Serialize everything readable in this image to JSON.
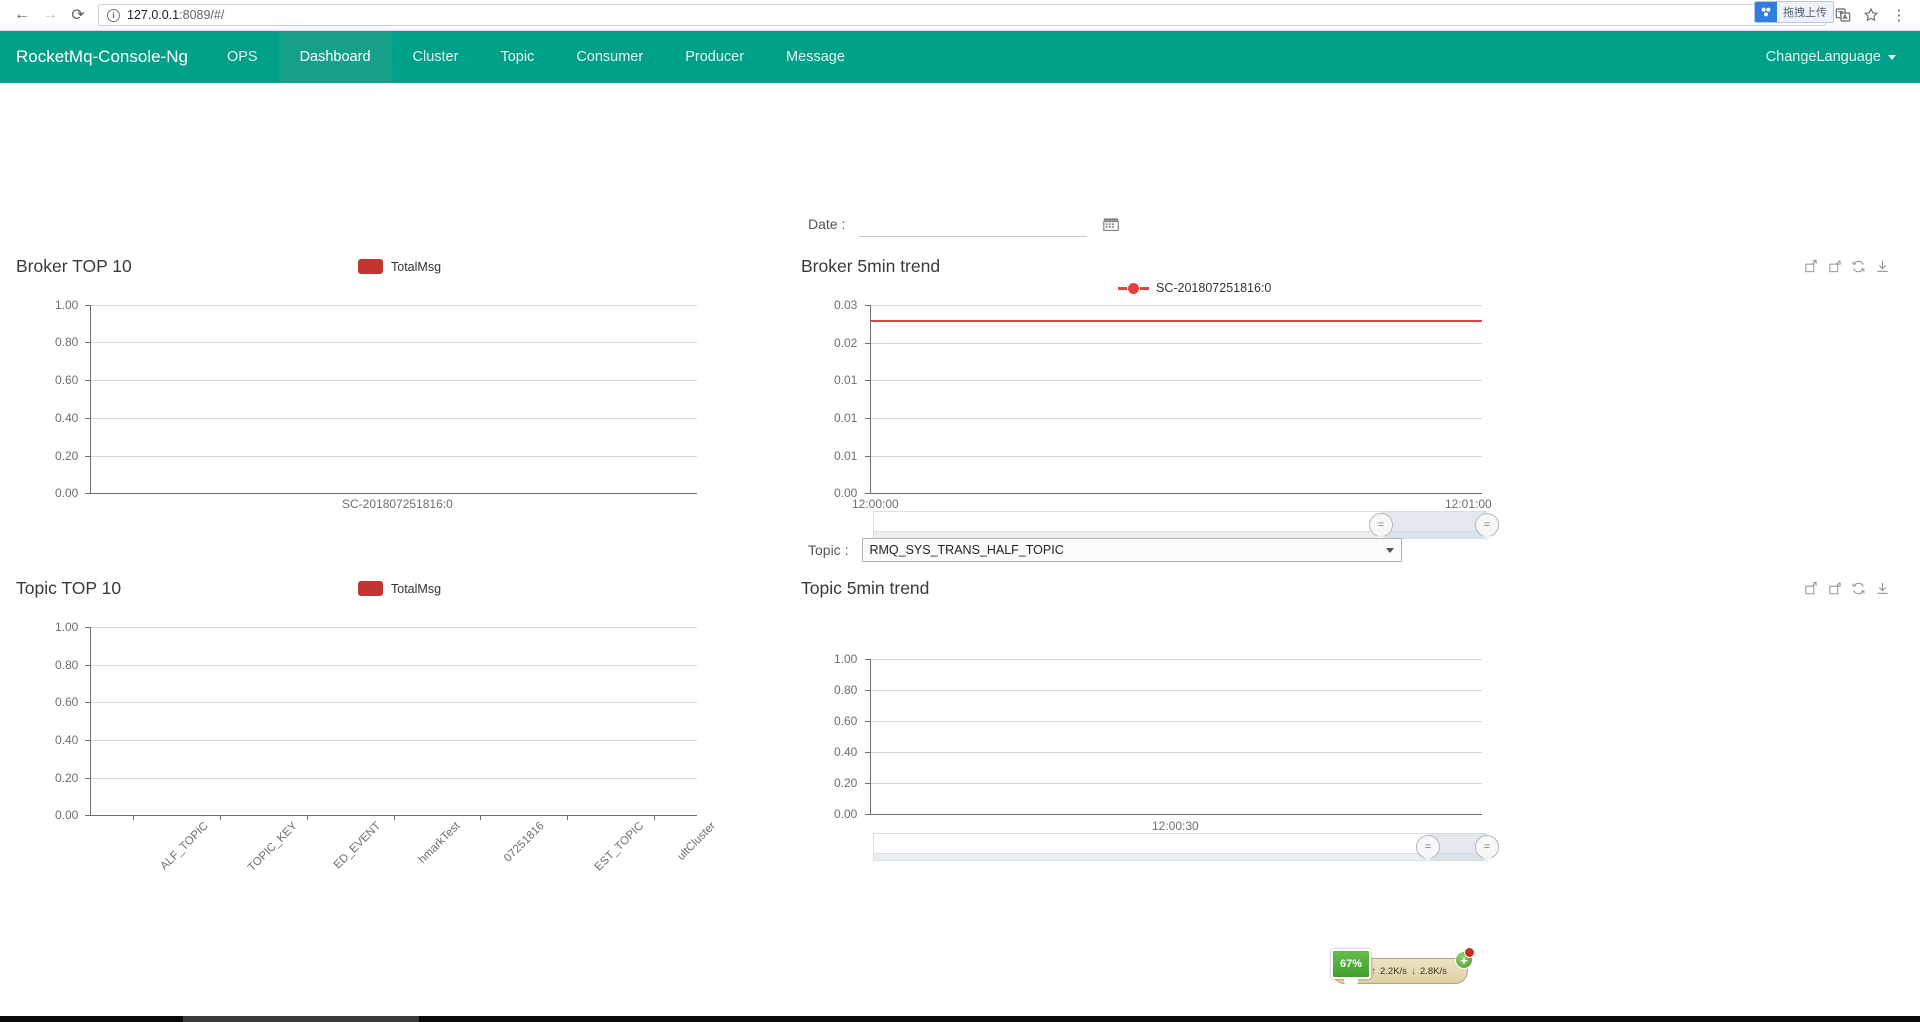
{
  "browser": {
    "back_icon": "back-arrow-icon",
    "forward_icon": "forward-arrow-icon",
    "reload_icon": "reload-icon",
    "url_host": "127.0.0.1",
    "url_rest": ":8089/#/",
    "extension_badge_label": "拖拽上传",
    "translate_icon": "translate-icon",
    "bookmark_icon": "star-icon",
    "menu_icon": "three-dots-menu-icon"
  },
  "appnav": {
    "brand": "RocketMq-Console-Ng",
    "items": [
      {
        "label": "OPS",
        "active": false
      },
      {
        "label": "Dashboard",
        "active": true
      },
      {
        "label": "Cluster",
        "active": false
      },
      {
        "label": "Topic",
        "active": false
      },
      {
        "label": "Consumer",
        "active": false
      },
      {
        "label": "Producer",
        "active": false
      },
      {
        "label": "Message",
        "active": false
      }
    ],
    "language_label": "ChangeLanguage",
    "accent_color": "#00a088",
    "active_color": "#169f89"
  },
  "date_filter": {
    "label": "Date :",
    "value": "",
    "placeholder": "",
    "calendar_icon": "calendar-icon"
  },
  "topic_filter": {
    "label": "Topic :",
    "selected": "RMQ_SYS_TRANS_HALF_TOPIC"
  },
  "toolbox": {
    "datazoom_label": "data-zoom-icon",
    "restore_label": "restore-icon",
    "refresh_label": "refresh-icon",
    "download_label": "download-icon"
  },
  "net_widget": {
    "cpu": "67%",
    "upload": "2.2K/s",
    "download": "2.8K/s",
    "up_arrow": "↑",
    "down_arrow": "↓",
    "plus": "+"
  },
  "chart_data": [
    {
      "id": "broker-top10",
      "type": "bar",
      "title": "Broker TOP 10",
      "legend": [
        "TotalMsg"
      ],
      "legend_position": "top-center",
      "categories": [
        "SC-201807251816:0"
      ],
      "series": [
        {
          "name": "TotalMsg",
          "values": [
            0
          ],
          "color": "#c23531"
        }
      ],
      "xlabel": "",
      "ylabel": "",
      "ylim": [
        0,
        1
      ],
      "yticks": [
        "0.00",
        "0.20",
        "0.40",
        "0.60",
        "0.80",
        "1.00"
      ],
      "grid": true
    },
    {
      "id": "broker-5min-trend",
      "type": "line",
      "title": "Broker 5min trend",
      "legend": [
        "SC-201807251816:0"
      ],
      "legend_position": "top-center",
      "x": [
        "12:00:00",
        "12:01:00"
      ],
      "xticks": [
        "12:00:00",
        "12:01:00"
      ],
      "series": [
        {
          "name": "SC-201807251816:0",
          "values": [
            0.0245,
            0.0245
          ],
          "color": "#e8403a"
        }
      ],
      "xlabel": "",
      "ylabel": "",
      "ylim": [
        0,
        0.03
      ],
      "yticks": [
        "0.00",
        "0.01",
        "0.01",
        "0.01",
        "0.02",
        "0.03"
      ],
      "grid": true,
      "datazoom": {
        "start": 0,
        "end": 88
      }
    },
    {
      "id": "topic-top10",
      "type": "bar",
      "title": "Topic TOP 10",
      "legend": [
        "TotalMsg"
      ],
      "legend_position": "top-center",
      "categories": [
        "ALF_TOPIC",
        "TOPIC_KEY",
        "ED_EVENT",
        "hmarkTest",
        "07251816",
        "EST_TOPIC",
        "ultCluster"
      ],
      "series": [
        {
          "name": "TotalMsg",
          "values": [
            0,
            0,
            0,
            0,
            0,
            0,
            0
          ],
          "color": "#c23531"
        }
      ],
      "xlabel": "",
      "ylabel": "",
      "ylim": [
        0,
        1
      ],
      "yticks": [
        "0.00",
        "0.20",
        "0.40",
        "0.60",
        "0.80",
        "1.00"
      ],
      "grid": true
    },
    {
      "id": "topic-5min-trend",
      "type": "line",
      "title": "Topic 5min trend",
      "legend": [],
      "x": [
        "12:00:30"
      ],
      "xticks": [
        "12:00:30"
      ],
      "series": [],
      "xlabel": "",
      "ylabel": "",
      "ylim": [
        0,
        1
      ],
      "yticks": [
        "0.00",
        "0.20",
        "0.40",
        "0.60",
        "0.80",
        "1.00"
      ],
      "grid": true,
      "datazoom": {
        "start": 0,
        "end": 88
      }
    }
  ]
}
